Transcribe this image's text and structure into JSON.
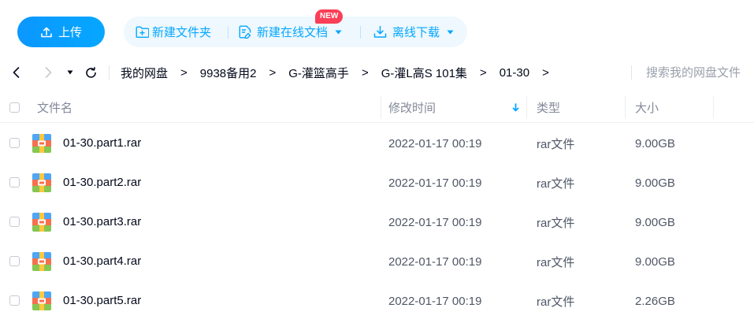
{
  "toolbar": {
    "upload_label": "上传",
    "new_folder_label": "新建文件夹",
    "new_doc_label": "新建在线文档",
    "new_badge": "NEW",
    "offline_download_label": "离线下载"
  },
  "navigation": {
    "breadcrumb": [
      {
        "label": "我的网盘"
      },
      {
        "label": "9938备用2"
      },
      {
        "label": "G-灌篮高手"
      },
      {
        "label": "G-灌L高S 101集"
      },
      {
        "label": "01-30"
      }
    ],
    "separator": ">",
    "search_placeholder": "搜索我的网盘文件"
  },
  "file_list": {
    "columns": {
      "name": "文件名",
      "modified": "修改时间",
      "type": "类型",
      "size": "大小"
    },
    "files": [
      {
        "name": "01-30.part1.rar",
        "modified": "2022-01-17 00:19",
        "type": "rar文件",
        "size": "9.00GB",
        "checked": false
      },
      {
        "name": "01-30.part2.rar",
        "modified": "2022-01-17 00:19",
        "type": "rar文件",
        "size": "9.00GB",
        "checked": false
      },
      {
        "name": "01-30.part3.rar",
        "modified": "2022-01-17 00:19",
        "type": "rar文件",
        "size": "9.00GB",
        "checked": false
      },
      {
        "name": "01-30.part4.rar",
        "modified": "2022-01-17 00:19",
        "type": "rar文件",
        "size": "9.00GB",
        "checked": false
      },
      {
        "name": "01-30.part5.rar",
        "modified": "2022-01-17 00:19",
        "type": "rar文件",
        "size": "2.26GB",
        "checked": false
      }
    ]
  },
  "icons": {
    "upload": "upload-icon",
    "new_folder": "folder-plus-icon",
    "new_doc": "document-edit-icon",
    "offline_download": "download-icon",
    "dropdown": "caret-down-icon",
    "back": "chevron-left-icon",
    "forward": "chevron-right-icon",
    "history": "caret-down-icon",
    "refresh": "refresh-icon",
    "sort": "arrow-down-icon",
    "file_type": "rar-archive-icon"
  },
  "colors": {
    "accent": "#06a7ff",
    "upload_button": "#0b97ff",
    "action_bar_background": "#eef8fe",
    "new_badge": "#fb3f57",
    "text_primary": "#03081a",
    "text_secondary": "#818999",
    "disabled": "#c5cad3"
  }
}
